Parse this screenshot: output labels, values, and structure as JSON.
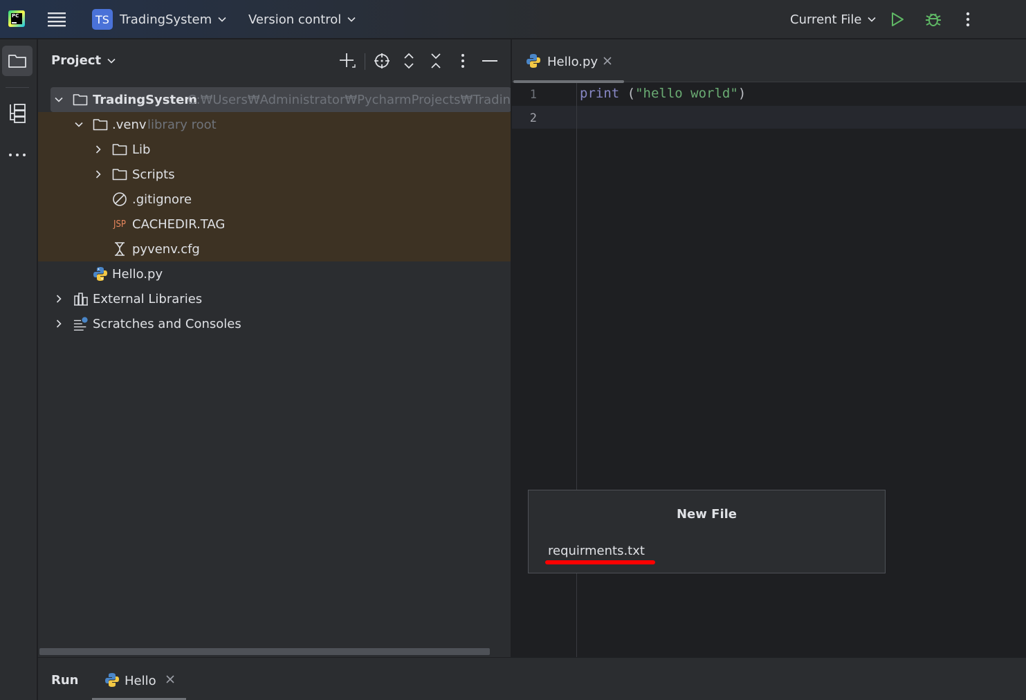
{
  "titlebar": {
    "logo_text": "PC",
    "project_badge": "TS",
    "project_name": "TradingSystem",
    "vcs_label": "Version control",
    "run_config": "Current File"
  },
  "colors": {
    "accent_green": "#5fb865",
    "library_root_bg": "#3d3223",
    "selection_bg": "#43454a",
    "annotation_red": "#ff0000"
  },
  "project": {
    "title": "Project",
    "tree": [
      {
        "label": "TradingSystem",
        "hint": "C:₩Users₩Administrator₩PycharmProjects₩TradingSystem",
        "icon": "folder-icon",
        "expanded": true
      },
      {
        "label": ".venv",
        "hint": "library root",
        "icon": "folder-icon",
        "expanded": true
      },
      {
        "label": "Lib",
        "icon": "folder-icon",
        "expanded": false
      },
      {
        "label": "Scripts",
        "icon": "folder-icon",
        "expanded": false
      },
      {
        "label": ".gitignore",
        "icon": "ignore-file-icon"
      },
      {
        "label": "CACHEDIR.TAG",
        "icon": "jsp-file-icon",
        "icon_text": "JSP"
      },
      {
        "label": "pyvenv.cfg",
        "icon": "config-file-icon"
      },
      {
        "label": "Hello.py",
        "icon": "python-file-icon"
      },
      {
        "label": "External Libraries",
        "icon": "libraries-icon",
        "expanded": false
      },
      {
        "label": "Scratches and Consoles",
        "icon": "scratches-icon",
        "expanded": false
      }
    ]
  },
  "editor": {
    "tab_label": "Hello.py",
    "line_numbers": [
      "1",
      "2"
    ],
    "code": {
      "keyword": "print",
      "open": " (",
      "string": "\"hello world\"",
      "close": ")"
    }
  },
  "new_file_dialog": {
    "title": "New File",
    "value": "requirments.txt"
  },
  "run_panel": {
    "title": "Run",
    "tab_label": "Hello"
  }
}
